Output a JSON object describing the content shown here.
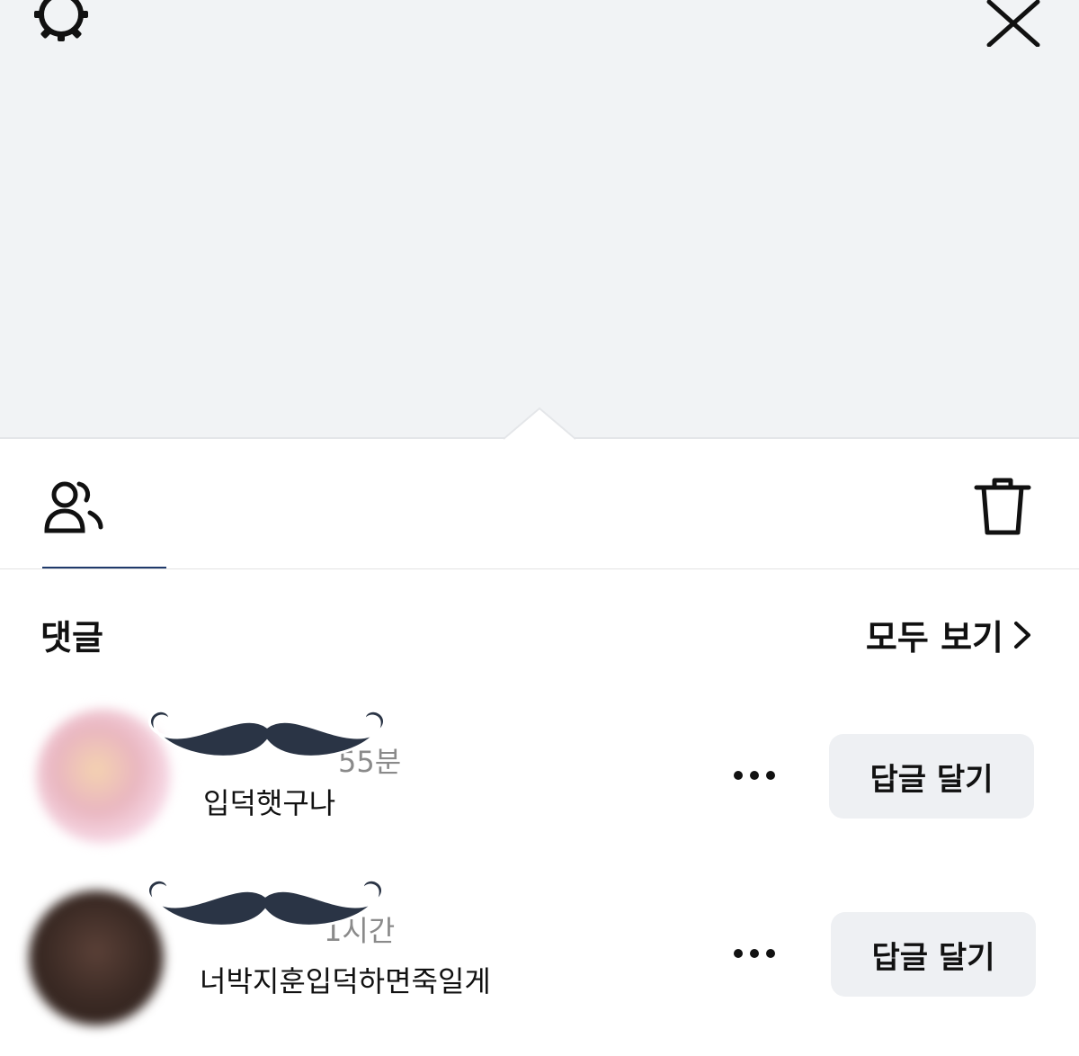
{
  "header": {
    "settings_icon": "gear-icon",
    "close_icon": "close-icon"
  },
  "viewer_bar": {
    "viewers_icon": "viewers-icon",
    "viewer_count": "",
    "delete_icon": "trash-icon"
  },
  "comments_section": {
    "title": "댓글",
    "see_all_label": "모두 보기",
    "see_all_icon": "chevron-right-icon"
  },
  "comments": [
    {
      "author": "",
      "time": "55분",
      "text": "입덕햇구나",
      "more_icon": "more-icon",
      "reply_label": "답글 달기"
    },
    {
      "author": "",
      "time": "1시간",
      "text": "너박지훈입덕하면죽일게",
      "more_icon": "more-icon",
      "reply_label": "답글 달기"
    }
  ],
  "colors": {
    "top_background": "#f1f3f5",
    "tab_underline": "#1f3a6b",
    "reply_button_background": "#eef0f3",
    "sticker": "#2a3445"
  }
}
